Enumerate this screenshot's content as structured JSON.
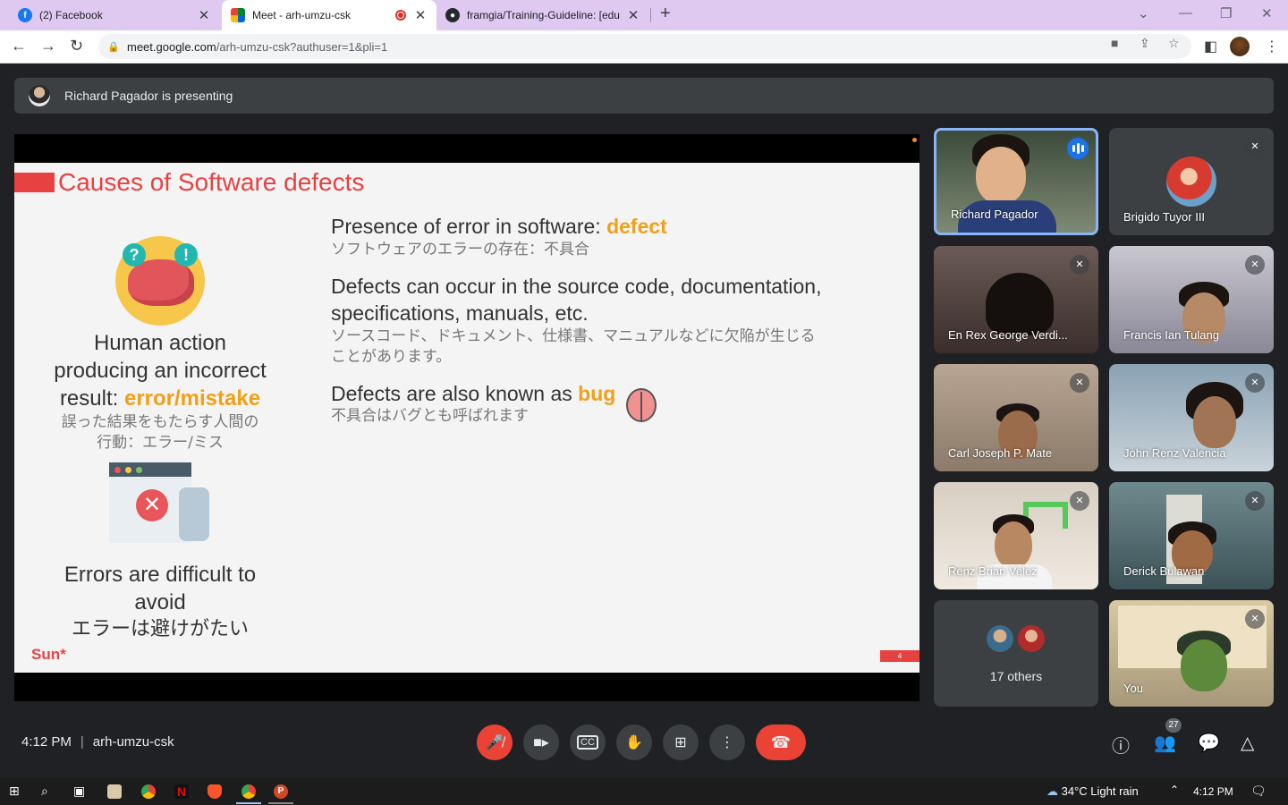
{
  "browser": {
    "tabs": [
      {
        "title": "(2) Facebook",
        "favicon": "facebook-icon"
      },
      {
        "title": "Meet - arh-umzu-csk",
        "favicon": "google-meet-icon",
        "recording": true
      },
      {
        "title": "framgia/Training-Guideline: [edu",
        "favicon": "github-icon"
      }
    ],
    "url_host": "meet.google.com",
    "url_path": "/arh-umzu-csk?authuser=1&pli=1"
  },
  "banner": {
    "text": "Richard Pagador is presenting"
  },
  "slide": {
    "title": "Causes of Software defects",
    "left": {
      "human_line1": "Human action",
      "human_line2": "producing an incorrect",
      "human_line3_prefix": "result: ",
      "human_highlight": "error/mistake",
      "human_jp": "誤った結果をもたらす人間の",
      "human_jp2": "行動：エラー/ミス",
      "errors_line1": "Errors are difficult to",
      "errors_line2": "avoid",
      "errors_jp": "エラーは避けがたい"
    },
    "bullets": {
      "b1_prefix": "Presence of error in software: ",
      "b1_highlight": "defect",
      "b1_jp": "ソフトウェアのエラーの存在：不具合",
      "b2_line1": "Defects can occur in the source code, documentation,",
      "b2_line2": "specifications, manuals, etc.",
      "b2_jp1": "ソースコード、ドキュメント、仕様書、マニュアルなどに欠陥が生じる",
      "b2_jp2": "ことがあります。",
      "b3_prefix": "Defects are also known as ",
      "b3_highlight": "bug",
      "b3_jp": "不具合はバグとも呼ばれます"
    },
    "brand": "Sun*",
    "page_number": "4"
  },
  "participants": [
    {
      "name": "Richard Pagador",
      "speaking": true
    },
    {
      "name": "Brigido Tuyor III",
      "muted": true
    },
    {
      "name": "En Rex George Verdi...",
      "muted": true
    },
    {
      "name": "Francis Ian Tulang",
      "muted": true
    },
    {
      "name": "Carl Joseph P. Mate",
      "muted": true
    },
    {
      "name": "John Renz Valencia",
      "muted": true
    },
    {
      "name": "Renz Brian Velez",
      "muted": true
    },
    {
      "name": "Derick Bulawan",
      "muted": true
    },
    {
      "name": "17 others"
    },
    {
      "name": "You",
      "muted": true
    }
  ],
  "meeting": {
    "time": "4:12 PM",
    "code": "arh-umzu-csk",
    "participant_count": "27"
  },
  "taskbar": {
    "weather_temp": "34°C",
    "weather_desc": "Light rain",
    "time": "4:12 PM"
  },
  "colors": {
    "accent_red": "#ea4335",
    "slide_red": "#e84142",
    "highlight_orange": "#f0a01a",
    "meet_bg": "#202124",
    "active_border": "#8ab4f8"
  }
}
